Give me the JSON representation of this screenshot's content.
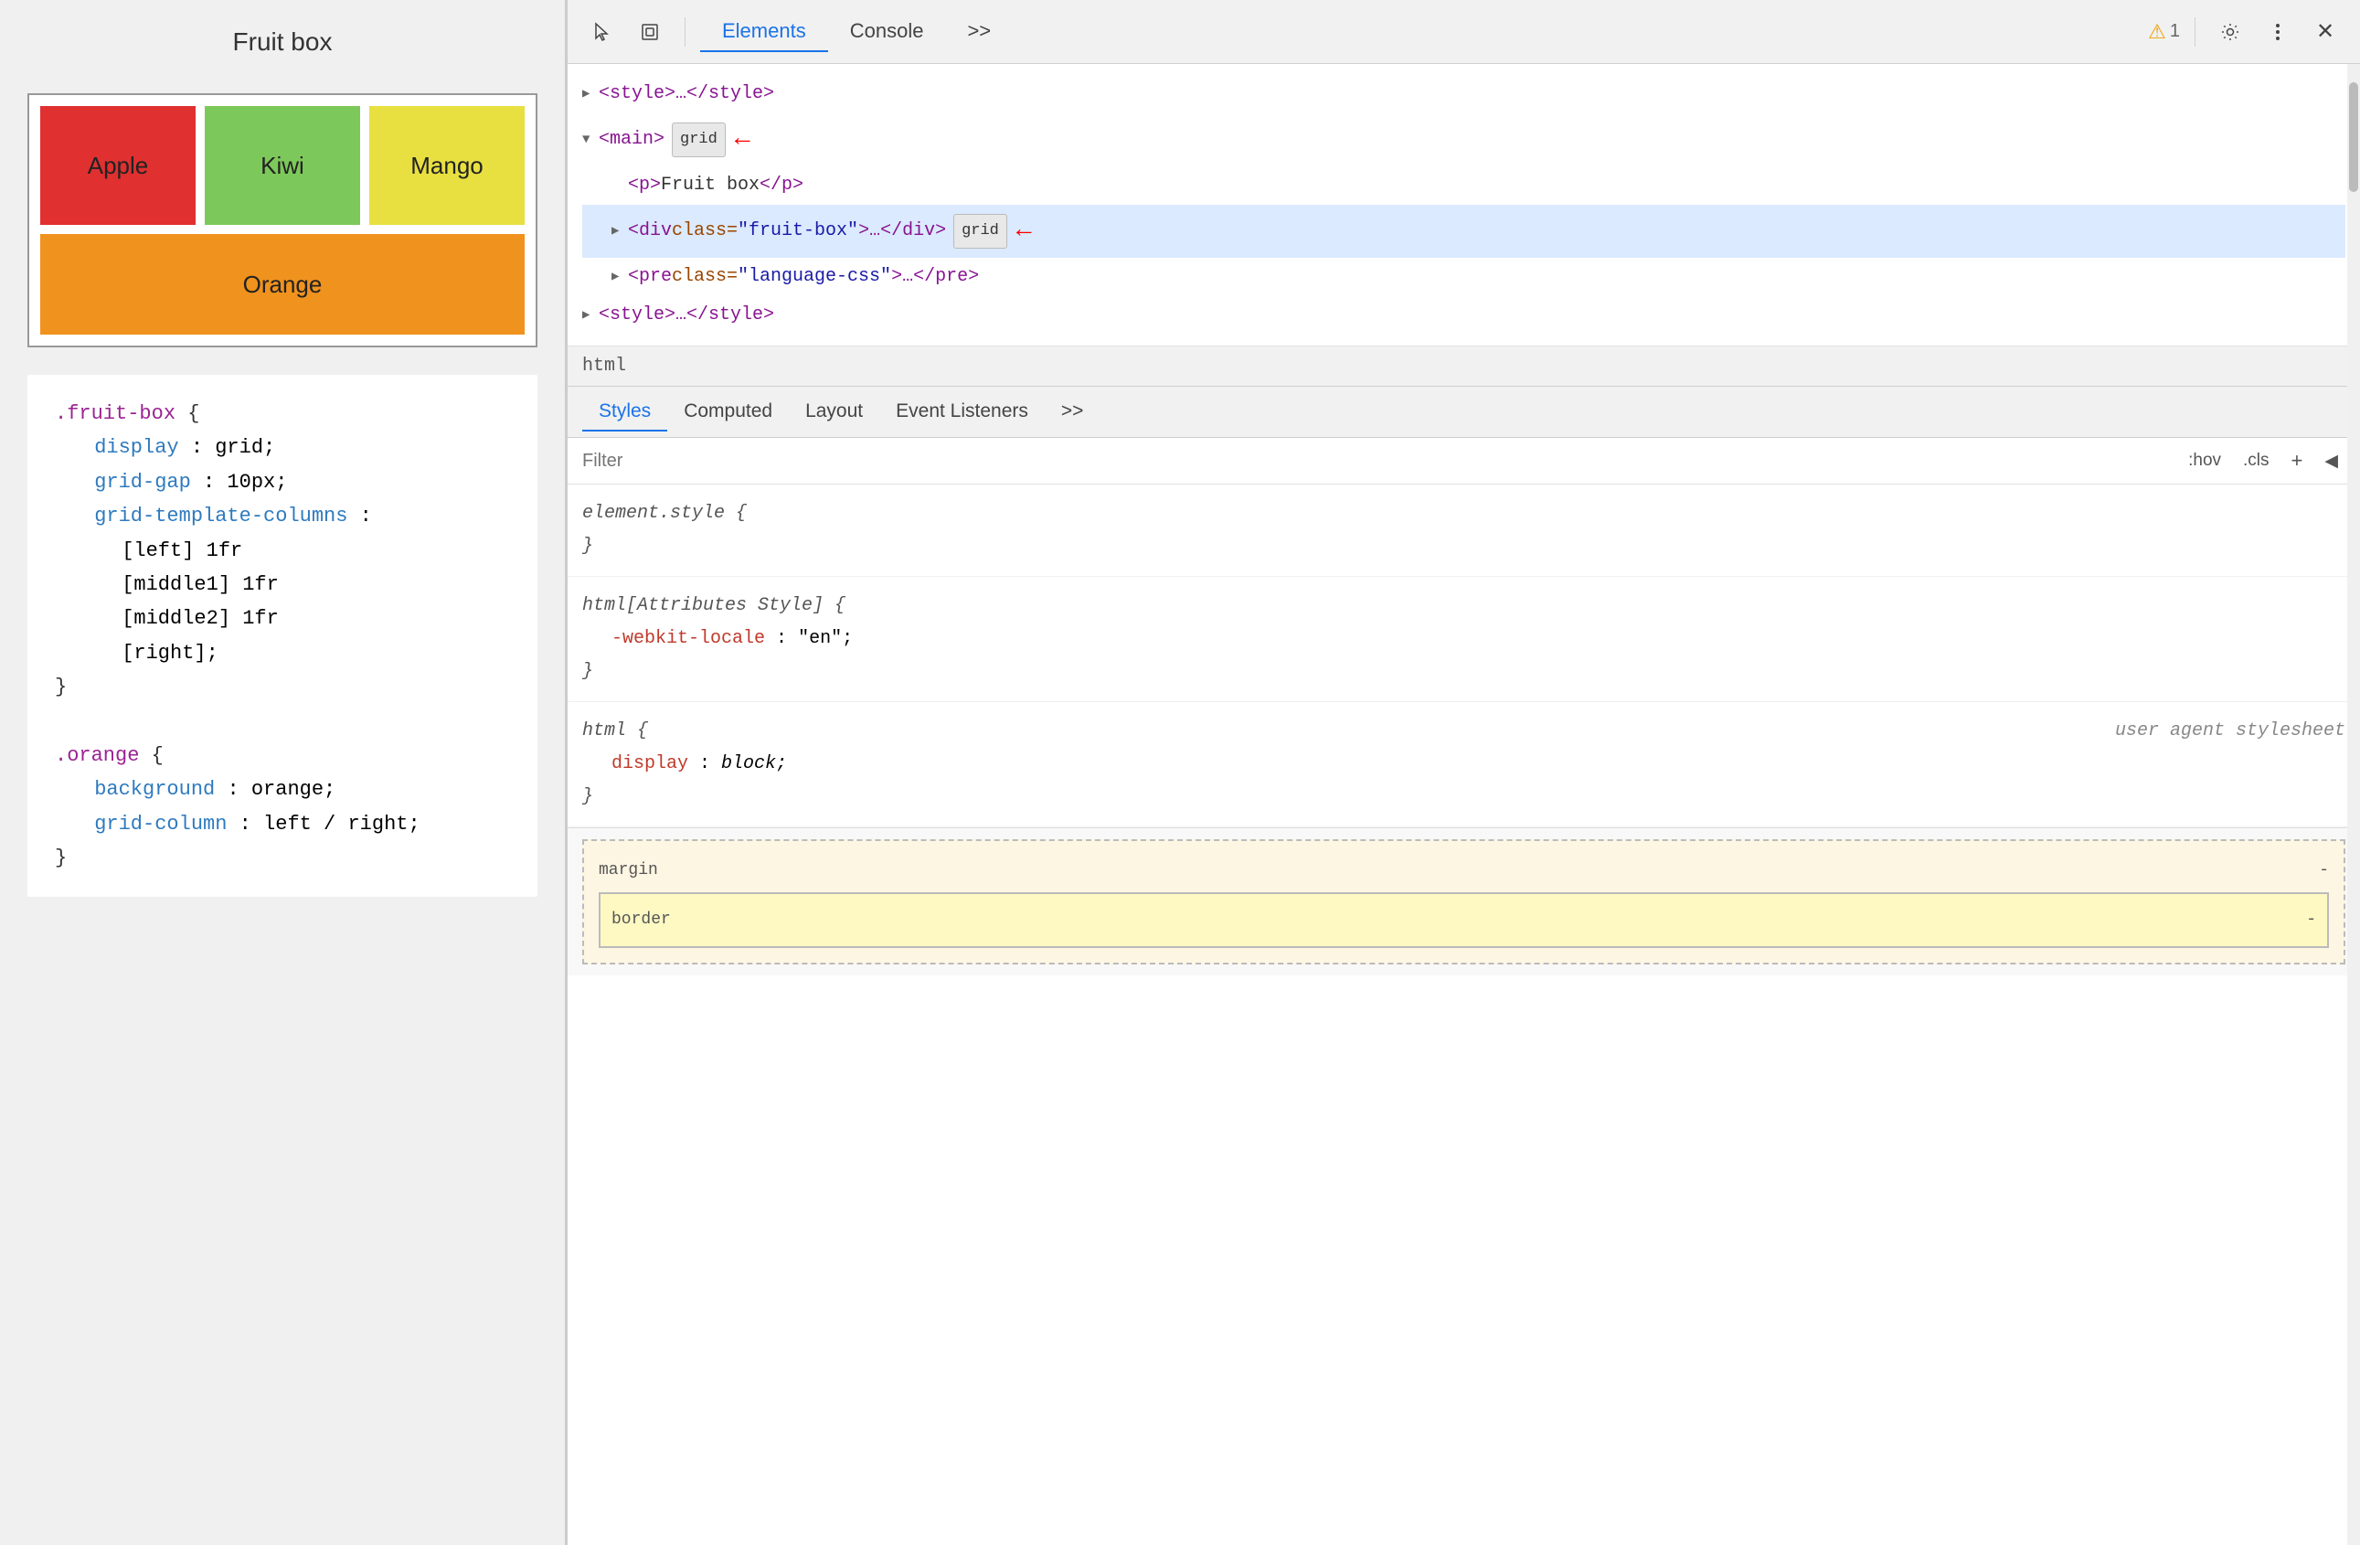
{
  "app": {
    "title": "Fruit box"
  },
  "left": {
    "panel_title": "Fruit box",
    "fruits": [
      {
        "name": "Apple",
        "class": "fruit-apple"
      },
      {
        "name": "Kiwi",
        "class": "fruit-kiwi"
      },
      {
        "name": "Mango",
        "class": "fruit-mango"
      },
      {
        "name": "Orange",
        "class": "fruit-orange"
      }
    ],
    "code_blocks": [
      {
        "selector": ".fruit-box",
        "properties": [
          {
            "name": "display",
            "value": "grid;"
          },
          {
            "name": "grid-gap",
            "value": "10px;"
          },
          {
            "name": "grid-template-columns",
            "value": ""
          },
          {
            "name": "",
            "value": "[left] 1fr"
          },
          {
            "name": "",
            "value": "[middle1] 1fr"
          },
          {
            "name": "",
            "value": "[middle2] 1fr"
          },
          {
            "name": "",
            "value": "[right];"
          }
        ]
      },
      {
        "selector": ".orange",
        "properties": [
          {
            "name": "background",
            "value": "orange;"
          },
          {
            "name": "grid-column",
            "value": "left / right;"
          }
        ]
      }
    ]
  },
  "devtools": {
    "toolbar": {
      "tabs": [
        "Elements",
        "Console",
        ">>"
      ],
      "active_tab": "Elements",
      "warning_count": "1",
      "icons": [
        "cursor-icon",
        "box-icon",
        "gear-icon",
        "dots-icon",
        "close-icon"
      ]
    },
    "dom_tree": {
      "lines": [
        {
          "indent": 0,
          "arrow": "▶",
          "content": "<style>…</style>",
          "badge": "",
          "selected": false
        },
        {
          "indent": 0,
          "arrow": "▼",
          "content": "<main>",
          "badge": "grid",
          "selected": false,
          "red_arrow": true
        },
        {
          "indent": 1,
          "arrow": "",
          "content": "<p>Fruit box</p>",
          "badge": "",
          "selected": false
        },
        {
          "indent": 1,
          "arrow": "▶",
          "content": "<div class=\"fruit-box\">…</div>",
          "badge": "grid",
          "selected": true,
          "red_arrow": true
        },
        {
          "indent": 1,
          "arrow": "▶",
          "content": "<pre class=\"language-css\">…</pre>",
          "badge": "",
          "selected": false
        },
        {
          "indent": 0,
          "arrow": "▶",
          "content": "<style>…</style>",
          "badge": "",
          "selected": false
        }
      ]
    },
    "breadcrumb": "html",
    "style_tabs": [
      "Styles",
      "Computed",
      "Layout",
      "Event Listeners",
      ">>"
    ],
    "active_style_tab": "Styles",
    "filter": {
      "placeholder": "Filter",
      "hov_label": ":hov",
      "cls_label": ".cls",
      "plus_label": "+",
      "collapse_label": "◀"
    },
    "styles": [
      {
        "selector": "element.style {",
        "properties": [],
        "close": "}"
      },
      {
        "selector": "html[Attributes Style] {",
        "properties": [
          {
            "name": "-webkit-locale",
            "value": "\"en\";"
          }
        ],
        "close": "}"
      },
      {
        "selector": "html {",
        "comment": "user agent stylesheet",
        "properties": [
          {
            "name": "display",
            "value": "block;"
          }
        ],
        "close": "}"
      }
    ],
    "box_model": {
      "margin_label": "margin",
      "margin_value": "-",
      "border_label": "border",
      "border_value": "-"
    }
  }
}
